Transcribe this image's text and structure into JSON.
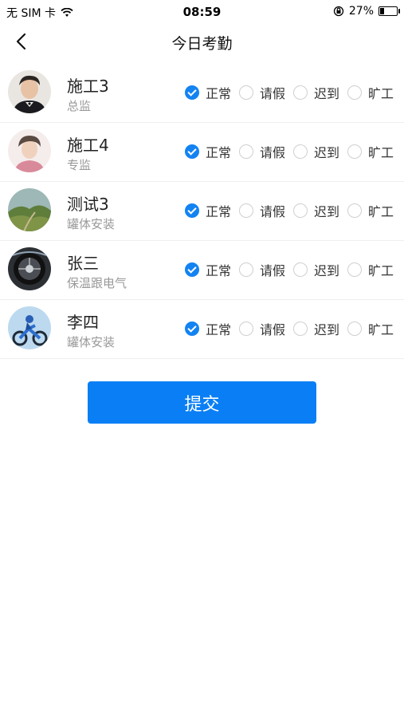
{
  "status_bar": {
    "carrier": "无 SIM 卡",
    "time": "08:59",
    "battery_percent": "27%",
    "battery_level": 0.27
  },
  "nav": {
    "title": "今日考勤"
  },
  "attendance_options": [
    "正常",
    "请假",
    "迟到",
    "旷工"
  ],
  "employees": [
    {
      "name": "施工3",
      "role": "总监",
      "selected": "正常"
    },
    {
      "name": "施工4",
      "role": "专监",
      "selected": "正常"
    },
    {
      "name": "测试3",
      "role": "罐体安装",
      "selected": "正常"
    },
    {
      "name": "张三",
      "role": "保温跟电气",
      "selected": "正常"
    },
    {
      "name": "李四",
      "role": "罐体安装",
      "selected": "正常"
    }
  ],
  "submit_label": "提交",
  "colors": {
    "accent": "#0a7ff5",
    "radio_checked": "#1383f2",
    "secondary_text": "#999999"
  }
}
